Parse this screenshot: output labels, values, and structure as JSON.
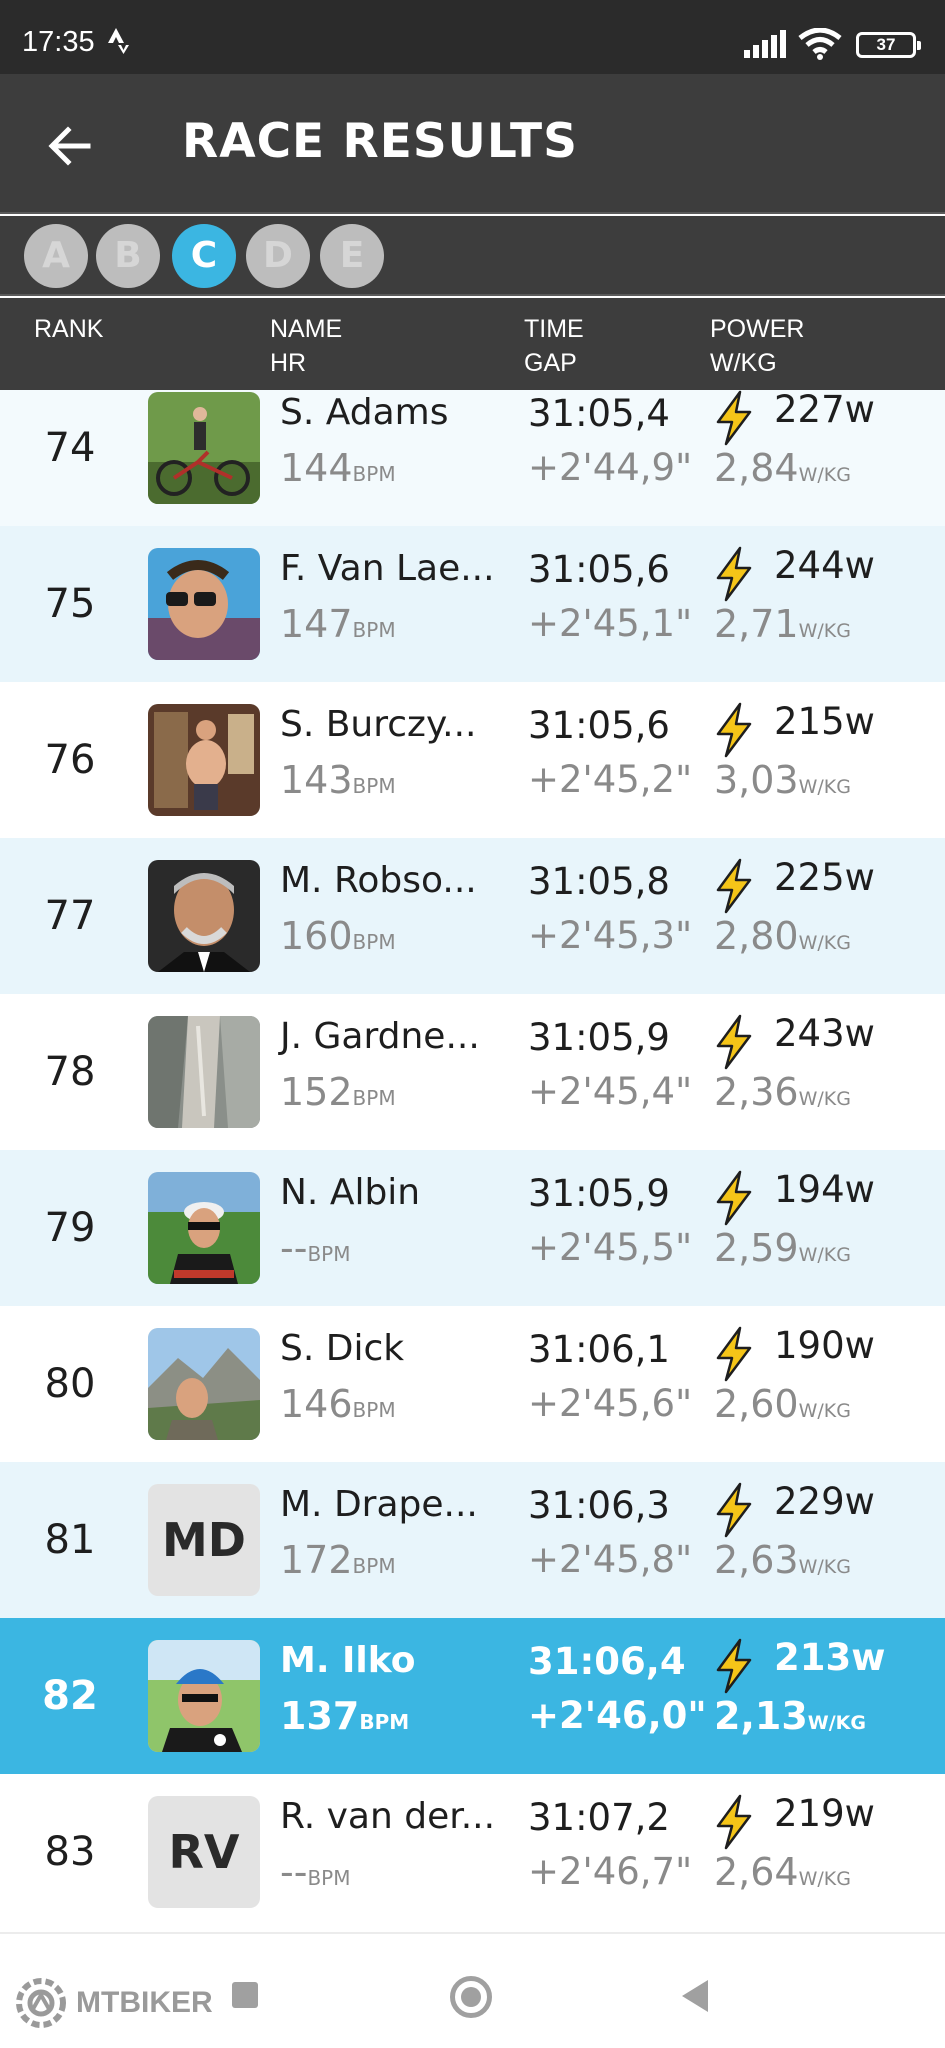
{
  "status": {
    "time": "17:35",
    "battery": "37"
  },
  "appbar": {
    "title": "RACE RESULTS"
  },
  "categories": [
    "A",
    "B",
    "C",
    "D",
    "E"
  ],
  "active_category": "C",
  "columns": {
    "rank": "RANK",
    "name": "NAME",
    "hr": "HR",
    "time": "TIME",
    "gap": "GAP",
    "power": "POWER",
    "wkg": "W/KG"
  },
  "units": {
    "bpm": "BPM",
    "w": "w",
    "wkg": "W/KG"
  },
  "rows": [
    {
      "rank": "74",
      "name": "S. Adams",
      "hr": "144",
      "time": "31:05,4",
      "gap": "+2'44,9\"",
      "watts": "227",
      "wkg": "2,84",
      "avatar": "photo"
    },
    {
      "rank": "75",
      "name": "F. Van Lae...",
      "hr": "147",
      "time": "31:05,6",
      "gap": "+2'45,1\"",
      "watts": "244",
      "wkg": "2,71",
      "avatar": "photo"
    },
    {
      "rank": "76",
      "name": "S. Burczy...",
      "hr": "143",
      "time": "31:05,6",
      "gap": "+2'45,2\"",
      "watts": "215",
      "wkg": "3,03",
      "avatar": "photo"
    },
    {
      "rank": "77",
      "name": "M. Robso...",
      "hr": "160",
      "time": "31:05,8",
      "gap": "+2'45,3\"",
      "watts": "225",
      "wkg": "2,80",
      "avatar": "photo"
    },
    {
      "rank": "78",
      "name": "J. Gardne...",
      "hr": "152",
      "time": "31:05,9",
      "gap": "+2'45,4\"",
      "watts": "243",
      "wkg": "2,36",
      "avatar": "photo"
    },
    {
      "rank": "79",
      "name": "N. Albin",
      "hr": "--",
      "time": "31:05,9",
      "gap": "+2'45,5\"",
      "watts": "194",
      "wkg": "2,59",
      "avatar": "photo"
    },
    {
      "rank": "80",
      "name": "S.  Dick",
      "hr": "146",
      "time": "31:06,1",
      "gap": "+2'45,6\"",
      "watts": "190",
      "wkg": "2,60",
      "avatar": "photo"
    },
    {
      "rank": "81",
      "name": "M. Drape...",
      "hr": "172",
      "time": "31:06,3",
      "gap": "+2'45,8\"",
      "watts": "229",
      "wkg": "2,63",
      "avatar": "MD"
    },
    {
      "rank": "82",
      "name": "M. Ilko",
      "hr": "137",
      "time": "31:06,4",
      "gap": "+2'46,0\"",
      "watts": "213",
      "wkg": "2,13",
      "avatar": "photo",
      "highlight": true
    },
    {
      "rank": "83",
      "name": "R. van der...",
      "hr": "--",
      "time": "31:07,2",
      "gap": "+2'46,7\"",
      "watts": "219",
      "wkg": "2,64",
      "avatar": "RV"
    }
  ],
  "watermark": "MTBIKER",
  "colors": {
    "accent": "#3bb6e2",
    "header": "#3d3d3d",
    "bolt": "#f5c518",
    "row_alt": "#e8f5fb"
  }
}
